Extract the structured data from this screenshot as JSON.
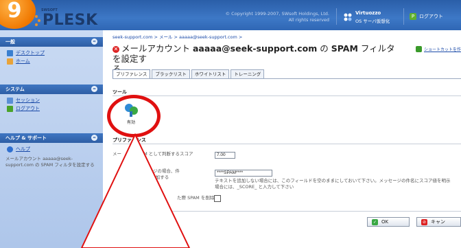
{
  "badge": {
    "step": "9"
  },
  "header": {
    "logo_small": "SWSOFT",
    "logo": "PLESK",
    "copyright_line1": "© Copyright 1999-2007, SWsoft Holdings, Ltd.",
    "copyright_line2": "All rights reserved",
    "virtuozzo_title": "Virtuozzo",
    "virtuozzo_sub": "OS サーバ仮想化",
    "logout_label": "ログアウト"
  },
  "sidebar": {
    "panels": [
      {
        "title": "一般",
        "items": [
          "デスクトップ",
          "ホーム"
        ]
      },
      {
        "title": "システム",
        "items": [
          "セッション",
          "ログアウト"
        ]
      },
      {
        "title": "ヘルプ & サポート",
        "items": [
          "ヘルプ"
        ],
        "help_text": "メールアカウント aaaaa@seek-support.com の SPAM フィルタを設定する"
      }
    ]
  },
  "main": {
    "breadcrumb": "seek-support.com > メール > aaaaa@seek-support.com >",
    "title_prefix": "メールアカウント ",
    "title_account": "aaaaa@seek-support.com",
    "title_mid": " の ",
    "title_spam": "SPAM",
    "title_suffix": " フィルタを設定す",
    "title_line2": "る",
    "shortcut_label": "ショートカットを作",
    "tabs": [
      "プリファレンス",
      "ブラックリスト",
      "ホワイトリスト",
      "トレーニング"
    ],
    "tools_heading": "ツール",
    "enable_label": "有効",
    "prefs_heading": "プリファレンス",
    "score_label_a": "メー",
    "score_label_b": "SPAM として判断するスコア",
    "score_value": "7.00",
    "subject_label_a": "したメッセージの場合、件",
    "subject_label_b": "テキストを追加する",
    "subject_value": "****SPAM****",
    "subject_hint_1": "テキストを追加しない場合には、このフィールドを空のままにしておいて下さい。メッセージの件名にスコア値を明示",
    "subject_hint_2": "場合には、_SCORE_ と入力して下さい",
    "delete_label": "た際 SPAM を削除",
    "ok_label": "OK",
    "cancel_label": "キャン"
  },
  "colors": {
    "accent_red": "#e01010",
    "header_blue": "#2f67b5"
  }
}
